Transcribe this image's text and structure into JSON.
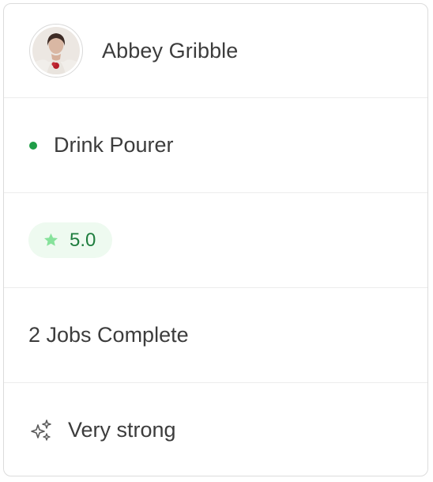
{
  "profile": {
    "name": "Abbey Gribble",
    "avatar_icon": "person-photo"
  },
  "role": {
    "label": "Drink Pourer",
    "status_color": "#1f9d47"
  },
  "rating": {
    "value": "5.0",
    "icon": "star-icon",
    "accent_color": "#1e7d3e",
    "background_color": "#eefaf0"
  },
  "jobs": {
    "label": "2 Jobs Complete"
  },
  "strength": {
    "label": "Very strong",
    "icon": "sparkle-icon"
  }
}
